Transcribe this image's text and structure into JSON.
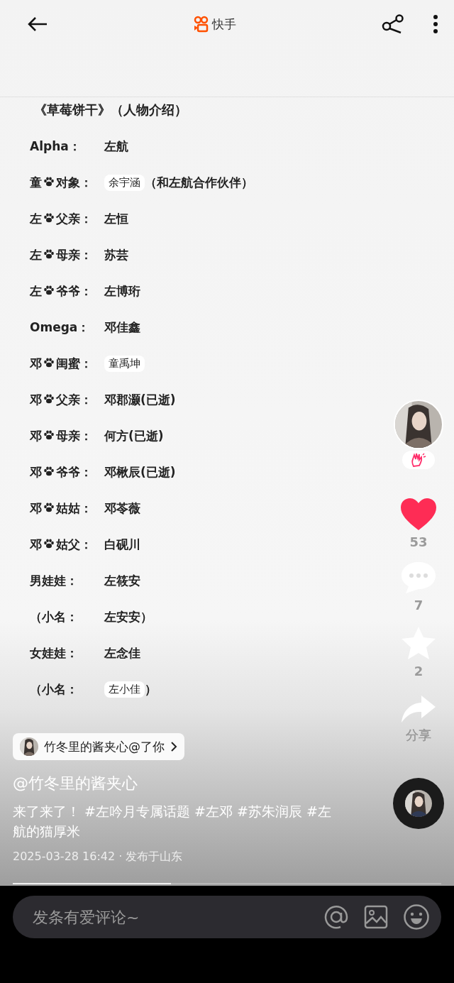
{
  "top_bar": {
    "app_name": "快手"
  },
  "note": {
    "title": "《草莓饼干》（人物介绍）",
    "lines": [
      {
        "label": "Alpha：",
        "value": "左航",
        "highlight": false
      },
      {
        "pre": "童",
        "label": "对象：",
        "value": "余宇涵",
        "highlight": true,
        "extra": "（和左航合作伙伴）"
      },
      {
        "pre": "左",
        "label": "父亲：",
        "value": "左恒",
        "highlight": false
      },
      {
        "pre": "左",
        "label": "母亲：",
        "value": "苏芸",
        "highlight": false
      },
      {
        "pre": "左",
        "label": "爷爷：",
        "value": "左博珩",
        "highlight": false
      },
      {
        "label": "Omega：",
        "value": "邓佳鑫",
        "highlight": false
      },
      {
        "pre": "邓",
        "label": "闺蜜：",
        "value": "童禹坤",
        "highlight": true
      },
      {
        "pre": "邓",
        "label": "父亲：",
        "value": "邓郡灏(已逝)",
        "highlight": false
      },
      {
        "pre": "邓",
        "label": "母亲：",
        "value": "何方(已逝)",
        "highlight": false
      },
      {
        "pre": "邓",
        "label": "爷爷：",
        "value": "邓楸辰(已逝)",
        "highlight": false
      },
      {
        "pre": "邓",
        "label": "姑姑：",
        "value": "邓苓薇",
        "highlight": false
      },
      {
        "pre": "邓",
        "label": "姑父：",
        "value": "白砚川",
        "highlight": false
      },
      {
        "label": "男娃娃：",
        "value": "左筱安",
        "highlight": false
      },
      {
        "label": "（小名：",
        "value": "左安安）",
        "highlight": false
      },
      {
        "label": "女娃娃：",
        "value": "左念佳",
        "highlight": false
      },
      {
        "label": "（小名：",
        "value": "左小佳",
        "highlight": true,
        "extra": "）"
      }
    ]
  },
  "actions": {
    "likes": "53",
    "liked": true,
    "comments": "7",
    "favorites": "2",
    "favorited": false,
    "share": "分享"
  },
  "mention": {
    "text": "竹冬里的酱夹心@了你"
  },
  "author": "@竹冬里的酱夹心",
  "caption": "来了来了！ #左吟月专属话题 #左邓 #苏朱润辰 #左航的猫厚米",
  "meta": "2025-03-28 16:42 · 发布于山东",
  "progress": {
    "level": 0.37
  },
  "comment_bar": {
    "placeholder": "发条有爱评论~"
  }
}
